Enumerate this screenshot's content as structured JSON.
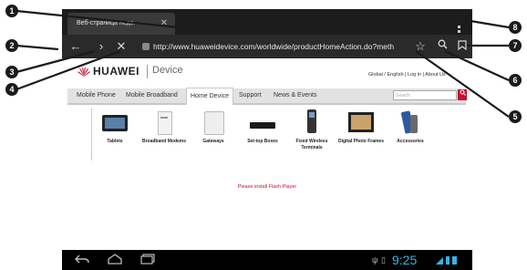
{
  "browser": {
    "tab_title": "Веб-страница недо.",
    "url": "http://www.huaweidevice.com/worldwide/productHomeAction.do?meth"
  },
  "site": {
    "logo_text": "HUAWEI",
    "logo_sub": "Device",
    "top_links": "Global / English  |  Log in  |  About Us",
    "nav": [
      "Mobile Phone",
      "Mobile Broadband",
      "Home Device",
      "Support",
      "News & Events"
    ],
    "search_placeholder": "Search",
    "categories": [
      "Tablets",
      "Broadband Modems",
      "Gateways",
      "Set-top Boxes",
      "Fixed Wireless Terminals",
      "Digital Photo Frames",
      "Accessories"
    ],
    "flash_message": "Please install Flash Player"
  },
  "system_bar": {
    "time": "9:25"
  },
  "callouts": [
    "1",
    "2",
    "3",
    "4",
    "5",
    "6",
    "7",
    "8"
  ],
  "colors": {
    "accent": "#33b5e5",
    "brand": "#c8102e",
    "chrome": "#2a2a2a"
  }
}
